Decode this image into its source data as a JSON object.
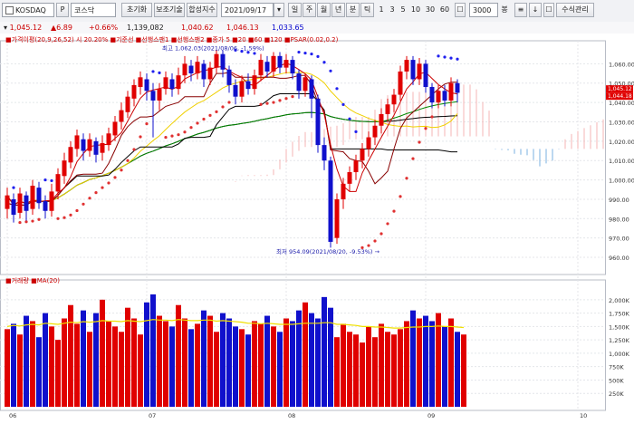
{
  "toolbar": {
    "symbol_code": "KOSDAQ",
    "search_label": "P",
    "symbol_name": "코스닥",
    "tabs": [
      "초기화",
      "보조기술",
      "합성지수"
    ],
    "date_value": "2021/09/17",
    "period_buttons": [
      "일",
      "주",
      "월",
      "년",
      "분",
      "틱"
    ],
    "interval_numbers": [
      "1",
      "3",
      "5",
      "10",
      "30",
      "60"
    ],
    "count_value": "3000",
    "count_unit": "봉",
    "right_button": "수식관리"
  },
  "infobar": {
    "items": [
      {
        "label": "1,045.12",
        "color": "#cc0000"
      },
      {
        "label": "▲6.89",
        "color": "#cc0000"
      },
      {
        "label": "+0.66%",
        "color": "#cc0000"
      },
      {
        "label": "1,139,082",
        "color": "#222222"
      },
      {
        "label": "1,040.62",
        "color": "#cc0000"
      },
      {
        "label": "1,046.13",
        "color": "#cc0000"
      },
      {
        "label": "1,033.65",
        "color": "#0000cc"
      }
    ]
  },
  "chart_data": [
    {
      "type": "candlestick",
      "title": "",
      "legend_text": "■가격이평(20,9,26,52) 시 20.20%  ■기준선  ■선행스팬1  ■선행스팬2  ■종가 5  ■20  ■60  ■120  ■PSAR(0.02,0.2)",
      "candles": [
        {
          "o": 985.0,
          "c": 992.0,
          "h": 996.0,
          "l": 980.0
        },
        {
          "o": 990.0,
          "c": 982.0,
          "h": 993.0,
          "l": 978.0
        },
        {
          "o": 983.0,
          "c": 993.0,
          "h": 996.0,
          "l": 980.0
        },
        {
          "o": 992.0,
          "c": 984.0,
          "h": 994.0,
          "l": 979.0
        },
        {
          "o": 985.0,
          "c": 997.0,
          "h": 1000.0,
          "l": 982.0
        },
        {
          "o": 996.0,
          "c": 988.0,
          "h": 999.0,
          "l": 985.0
        },
        {
          "o": 989.0,
          "c": 984.0,
          "h": 992.0,
          "l": 980.0
        },
        {
          "o": 984.0,
          "c": 994.0,
          "h": 998.0,
          "l": 981.0
        },
        {
          "o": 994.0,
          "c": 1003.0,
          "h": 1006.0,
          "l": 990.0
        },
        {
          "o": 1002.0,
          "c": 1010.0,
          "h": 1014.0,
          "l": 998.0
        },
        {
          "o": 1009.0,
          "c": 1017.0,
          "h": 1020.0,
          "l": 1006.0
        },
        {
          "o": 1016.0,
          "c": 1023.0,
          "h": 1026.0,
          "l": 1012.0
        },
        {
          "o": 1021.0,
          "c": 1015.0,
          "h": 1024.0,
          "l": 1010.0
        },
        {
          "o": 1015.0,
          "c": 1021.0,
          "h": 1024.0,
          "l": 1012.0
        },
        {
          "o": 1020.0,
          "c": 1013.0,
          "h": 1022.0,
          "l": 1009.0
        },
        {
          "o": 1014.0,
          "c": 1019.0,
          "h": 1023.0,
          "l": 1010.0
        },
        {
          "o": 1018.0,
          "c": 1024.0,
          "h": 1027.0,
          "l": 1015.0
        },
        {
          "o": 1023.0,
          "c": 1030.0,
          "h": 1033.0,
          "l": 1020.0
        },
        {
          "o": 1030.0,
          "c": 1036.0,
          "h": 1040.0,
          "l": 1026.0
        },
        {
          "o": 1035.0,
          "c": 1043.0,
          "h": 1046.0,
          "l": 1032.0
        },
        {
          "o": 1042.0,
          "c": 1049.0,
          "h": 1052.0,
          "l": 1038.0
        },
        {
          "o": 1048.0,
          "c": 1053.0,
          "h": 1056.0,
          "l": 1044.0
        },
        {
          "o": 1052.0,
          "c": 1046.0,
          "h": 1055.0,
          "l": 1041.0
        },
        {
          "o": 1046.0,
          "c": 1041.0,
          "h": 1050.0,
          "l": 1022.0
        },
        {
          "o": 1041.0,
          "c": 1047.0,
          "h": 1050.0,
          "l": 1036.0
        },
        {
          "o": 1047.0,
          "c": 1053.0,
          "h": 1056.0,
          "l": 1044.0
        },
        {
          "o": 1052.0,
          "c": 1047.0,
          "h": 1055.0,
          "l": 1043.0
        },
        {
          "o": 1047.0,
          "c": 1054.0,
          "h": 1058.0,
          "l": 1044.0
        },
        {
          "o": 1054.0,
          "c": 1060.0,
          "h": 1064.0,
          "l": 1050.0
        },
        {
          "o": 1059.0,
          "c": 1055.0,
          "h": 1062.0,
          "l": 1051.0
        },
        {
          "o": 1055.0,
          "c": 1061.0,
          "h": 1064.0,
          "l": 1052.0
        },
        {
          "o": 1060.0,
          "c": 1052.0,
          "h": 1062.0,
          "l": 1048.0
        },
        {
          "o": 1052.0,
          "c": 1058.0,
          "h": 1061.0,
          "l": 1049.0
        },
        {
          "o": 1058.0,
          "c": 1065.0,
          "h": 1067.0,
          "l": 1055.0
        },
        {
          "o": 1065.0,
          "c": 1057.0,
          "h": 1067.0,
          "l": 1053.0
        },
        {
          "o": 1057.0,
          "c": 1049.0,
          "h": 1059.0,
          "l": 1045.0
        },
        {
          "o": 1049.0,
          "c": 1043.0,
          "h": 1052.0,
          "l": 1039.0
        },
        {
          "o": 1043.0,
          "c": 1051.0,
          "h": 1054.0,
          "l": 1040.0
        },
        {
          "o": 1051.0,
          "c": 1047.0,
          "h": 1055.0,
          "l": 1044.0
        },
        {
          "o": 1047.0,
          "c": 1054.0,
          "h": 1057.0,
          "l": 1044.0
        },
        {
          "o": 1054.0,
          "c": 1062.0,
          "h": 1065.0,
          "l": 1051.0
        },
        {
          "o": 1061.0,
          "c": 1056.0,
          "h": 1064.0,
          "l": 1053.0
        },
        {
          "o": 1056.0,
          "c": 1064.0,
          "h": 1066.0,
          "l": 1053.0
        },
        {
          "o": 1064.0,
          "c": 1058.0,
          "h": 1066.0,
          "l": 1055.0
        },
        {
          "o": 1058.0,
          "c": 1062.0,
          "h": 1065.0,
          "l": 1055.0
        },
        {
          "o": 1062.0,
          "c": 1055.0,
          "h": 1064.0,
          "l": 1052.0
        },
        {
          "o": 1055.0,
          "c": 1046.0,
          "h": 1057.0,
          "l": 1042.0
        },
        {
          "o": 1046.0,
          "c": 1053.0,
          "h": 1055.0,
          "l": 1043.0
        },
        {
          "o": 1052.0,
          "c": 1042.0,
          "h": 1054.0,
          "l": 1032.0
        },
        {
          "o": 1042.0,
          "c": 1018.0,
          "h": 1044.0,
          "l": 1014.0
        },
        {
          "o": 1018.0,
          "c": 1010.0,
          "h": 1022.0,
          "l": 1005.0
        },
        {
          "o": 1010.0,
          "c": 968.0,
          "h": 1012.0,
          "l": 965.0
        },
        {
          "o": 970.0,
          "c": 990.0,
          "h": 993.0,
          "l": 967.0
        },
        {
          "o": 990.0,
          "c": 998.0,
          "h": 1001.0,
          "l": 985.0
        },
        {
          "o": 998.0,
          "c": 1004.0,
          "h": 1007.0,
          "l": 994.0
        },
        {
          "o": 1004.0,
          "c": 1010.0,
          "h": 1013.0,
          "l": 1000.0
        },
        {
          "o": 1010.0,
          "c": 1016.0,
          "h": 1019.0,
          "l": 1006.0
        },
        {
          "o": 1016.0,
          "c": 1022.0,
          "h": 1025.0,
          "l": 1012.0
        },
        {
          "o": 1022.0,
          "c": 1028.0,
          "h": 1031.0,
          "l": 1018.0
        },
        {
          "o": 1028.0,
          "c": 1034.0,
          "h": 1037.0,
          "l": 1024.0
        },
        {
          "o": 1034.0,
          "c": 1039.0,
          "h": 1042.0,
          "l": 1030.0
        },
        {
          "o": 1039.0,
          "c": 1044.0,
          "h": 1047.0,
          "l": 1035.0
        },
        {
          "o": 1044.0,
          "c": 1056.0,
          "h": 1059.0,
          "l": 1041.0
        },
        {
          "o": 1056.0,
          "c": 1062.0,
          "h": 1064.0,
          "l": 1052.0
        },
        {
          "o": 1062.0,
          "c": 1052.0,
          "h": 1064.0,
          "l": 1049.0
        },
        {
          "o": 1052.0,
          "c": 1060.0,
          "h": 1063.0,
          "l": 1049.0
        },
        {
          "o": 1060.0,
          "c": 1048.0,
          "h": 1062.0,
          "l": 1045.0
        },
        {
          "o": 1048.0,
          "c": 1040.0,
          "h": 1050.0,
          "l": 1037.0
        },
        {
          "o": 1040.0,
          "c": 1046.0,
          "h": 1049.0,
          "l": 1037.0
        },
        {
          "o": 1046.0,
          "c": 1041.0,
          "h": 1049.0,
          "l": 1038.0
        },
        {
          "o": 1041.0,
          "c": 1050.0,
          "h": 1053.0,
          "l": 1038.0
        },
        {
          "o": 1050.0,
          "c": 1045.0,
          "h": 1052.0,
          "l": 1040.0
        }
      ],
      "ylim": [
        953,
        1070
      ],
      "y_ticks": [
        {
          "value": 1060,
          "label": "1,060.00"
        },
        {
          "value": 1050,
          "label": "1,050.00"
        },
        {
          "value": 1040,
          "label": "1,040.00"
        },
        {
          "value": 1030,
          "label": "1,030.00"
        },
        {
          "value": 1020,
          "label": "1,020.00"
        },
        {
          "value": 1010,
          "label": "1,010.00"
        },
        {
          "value": 1000,
          "label": "1,000.00"
        },
        {
          "value": 990,
          "label": "990.00"
        },
        {
          "value": 980,
          "label": "980.00"
        },
        {
          "value": 970,
          "label": "970.00"
        },
        {
          "value": 960,
          "label": "960.00"
        }
      ],
      "current_price": 1045.12,
      "current_price_labels": [
        "1,045.12",
        "1,044.18"
      ],
      "annotations": [
        {
          "text": "최고 1,062.03(2021/08/06, -1.59%)",
          "near_index": 33,
          "value": 1067
        },
        {
          "text": "최저 954.09(2021/08/20, -9.53%) →",
          "near_index": 51,
          "value": 962
        }
      ],
      "x_ticks": [
        {
          "index": 0,
          "label": "06"
        },
        {
          "index": 22,
          "label": "07"
        },
        {
          "index": 44,
          "label": "08"
        },
        {
          "index": 66,
          "label": "09"
        },
        {
          "index": 90,
          "label": "10"
        }
      ],
      "grid": true
    },
    {
      "type": "bar",
      "title": "",
      "legend_text": "■거래량  ■MA(20)",
      "values": [
        1450,
        1550,
        1350,
        1700,
        1600,
        1300,
        1750,
        1500,
        1250,
        1650,
        1900,
        1550,
        1800,
        1400,
        1750,
        2000,
        1600,
        1500,
        1400,
        1850,
        1650,
        1350,
        1950,
        2100,
        1700,
        1600,
        1500,
        1900,
        1650,
        1450,
        1550,
        1800,
        1700,
        1400,
        1750,
        1650,
        1500,
        1450,
        1350,
        1600,
        1550,
        1700,
        1500,
        1400,
        1650,
        1600,
        1800,
        1950,
        1750,
        1650,
        2050,
        1850,
        1300,
        1550,
        1400,
        1350,
        1200,
        1500,
        1300,
        1550,
        1400,
        1350,
        1450,
        1600,
        1800,
        1650,
        1700,
        1600,
        1750,
        1500,
        1650,
        1400,
        1350
      ],
      "ma_values": [
        1500,
        1520,
        1510,
        1530,
        1540,
        1530,
        1560,
        1550,
        1540,
        1560,
        1580,
        1570,
        1590,
        1580,
        1590,
        1610,
        1600,
        1600,
        1590,
        1610,
        1600,
        1590,
        1610,
        1630,
        1620,
        1620,
        1610,
        1630,
        1620,
        1610,
        1610,
        1620,
        1620,
        1600,
        1610,
        1600,
        1590,
        1580,
        1560,
        1560,
        1550,
        1560,
        1550,
        1540,
        1540,
        1540,
        1550,
        1560,
        1560,
        1560,
        1570,
        1570,
        1540,
        1540,
        1530,
        1520,
        1500,
        1500,
        1490,
        1490,
        1480,
        1470,
        1470,
        1480,
        1490,
        1490,
        1500,
        1500,
        1510,
        1500,
        1500,
        1490,
        1480
      ],
      "ylim": [
        0,
        2200
      ],
      "y_ticks": [
        {
          "value": 2000,
          "label": "2,000K"
        },
        {
          "value": 1750,
          "label": "1,750K"
        },
        {
          "value": 1500,
          "label": "1,500K"
        },
        {
          "value": 1250,
          "label": "1,250K"
        },
        {
          "value": 1000,
          "label": "1,000K"
        },
        {
          "value": 750,
          "label": "750K"
        },
        {
          "value": 500,
          "label": "500K"
        },
        {
          "value": 250,
          "label": "250K"
        }
      ],
      "grid": true
    }
  ],
  "colors": {
    "up": "#e00000",
    "down": "#1010cc",
    "psar": "#e03030",
    "psar_up": "#2020ee",
    "ma5": "#cc0000",
    "ma20": "#f0d000",
    "ma60": "#008800",
    "ma120": "#000000",
    "base_line": "#000000",
    "conv_line": "#880000",
    "cloud_red": "#f4b4b4",
    "cloud_blue": "#7ab0e0"
  }
}
